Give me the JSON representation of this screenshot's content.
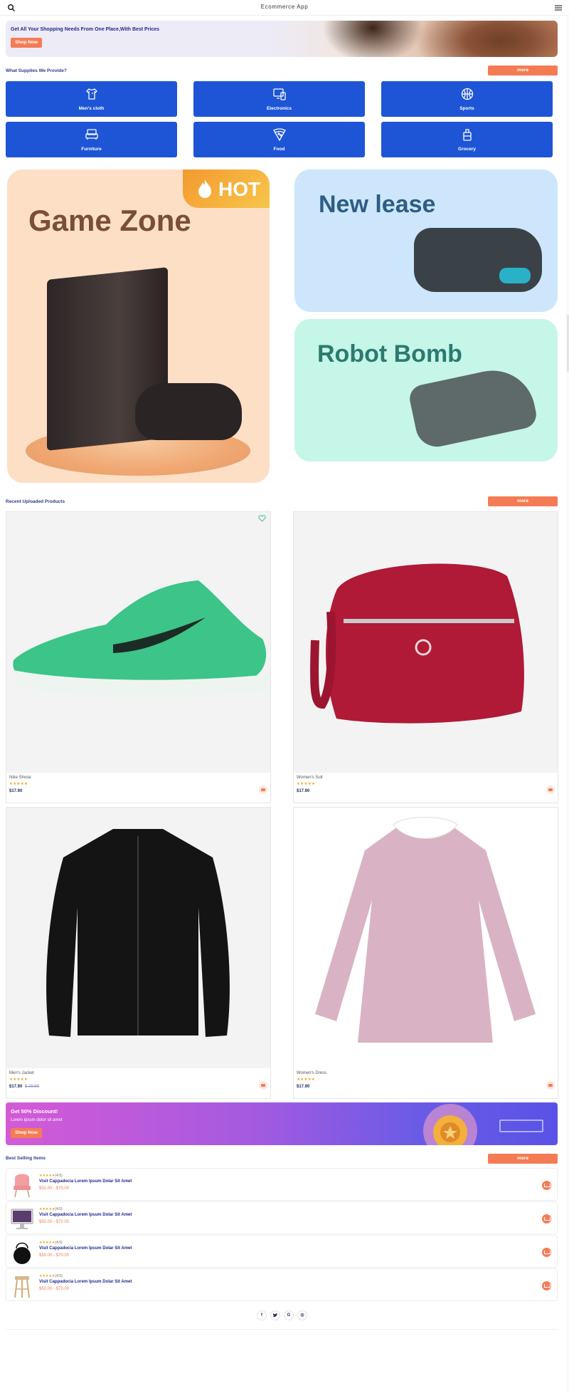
{
  "header": {
    "title": "Ecommerce App",
    "search_icon": "search-icon",
    "menu_icon": "hamburger-menu-icon"
  },
  "banner": {
    "headline": "Get All Your Shopping Needs From One Place,With Best Prices",
    "button": "Shop Now"
  },
  "supplies": {
    "title": "What Supplies We Provide?",
    "more": "more",
    "categories": [
      {
        "label": "Men's cloth",
        "icon": "shirt-icon"
      },
      {
        "label": "Electronics",
        "icon": "devices-icon"
      },
      {
        "label": "Sports",
        "icon": "basketball-icon"
      },
      {
        "label": "Furniture",
        "icon": "sofa-icon"
      },
      {
        "label": "Food",
        "icon": "pizza-icon"
      },
      {
        "label": "Grocery",
        "icon": "grocery-icon"
      }
    ]
  },
  "promos": [
    {
      "title": "Game Zone",
      "badge": "HOT"
    },
    {
      "title": "New lease"
    },
    {
      "title": "Robot Bomb"
    }
  ],
  "recent": {
    "title": "Recent Uploaded Products",
    "more": "more",
    "products": [
      {
        "name": "Nike Shose",
        "stars": "★★★★★",
        "price": "$17.90",
        "old_price": ""
      },
      {
        "name": "Women's Suit",
        "stars": "★★★★★",
        "price": "$17.90",
        "old_price": ""
      },
      {
        "name": "Men's Jacket",
        "stars": "★★★★★",
        "price": "$17.90",
        "old_price": "$ 29.99"
      },
      {
        "name": "Women's Dress",
        "stars": "★★★★★",
        "price": "$17.90",
        "old_price": ""
      }
    ]
  },
  "discount": {
    "headline": "Get 50% Discount!",
    "subtitle": "Lorem ipsum dolor sit amet",
    "button": "Shop Now"
  },
  "best": {
    "title": "Best Selling Items",
    "more": "more",
    "items": [
      {
        "stars": "★★★★★",
        "rating": "(4.5)",
        "name": "Visit Cappadocia Lorem Ipsum Dolar Sit Amet",
        "range": "$50.00 - $70.00"
      },
      {
        "stars": "★★★★★",
        "rating": "(4.5)",
        "name": "Visit Cappadocia Lorem Ipsum Dolar Sit Amet",
        "range": "$50.00 - $70.00"
      },
      {
        "stars": "★★★★★",
        "rating": "(4.5)",
        "name": "Visit Cappadocia Lorem Ipsum Dolar Sit Amet",
        "range": "$50.00 - $70.00"
      },
      {
        "stars": "★★★★★",
        "rating": "(4.5)",
        "name": "Visit Cappadocia Lorem Ipsum Dolar Sit Amet",
        "range": "$50.00 - $70.00"
      }
    ]
  },
  "social": [
    {
      "glyph": "f",
      "icon": "facebook-icon"
    },
    {
      "glyph": "🐦",
      "icon": "twitter-icon"
    },
    {
      "glyph": "G",
      "icon": "google-icon"
    },
    {
      "glyph": "◎",
      "icon": "instagram-icon"
    }
  ],
  "colors": {
    "accent": "#f47c55",
    "category_blue": "#1e55d6",
    "navy_text": "#1f2a8c"
  }
}
